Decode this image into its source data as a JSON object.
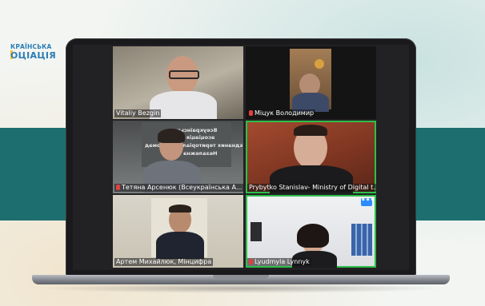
{
  "logo": {
    "line1": "КРАЇНСЬКА",
    "line2": "ОЦІАЦІЯ"
  },
  "meeting": {
    "more_button_label": "•••",
    "participants": [
      {
        "name": "Vitaliy Bezgin",
        "muted": false
      },
      {
        "name": "Міцук Володимир",
        "muted": true
      },
      {
        "name": "Тетяна Арсенюк (Всеукраїнська А...",
        "muted": true
      },
      {
        "name": "Prybytko Stanislav- Ministry of Digital t...",
        "muted": false
      },
      {
        "name": "Артем Михайлюк, Мінцифра",
        "muted": false
      },
      {
        "name": "Lyudmyla Lynnyk",
        "muted": true
      }
    ],
    "background_sign": {
      "line1": "Всеукраїнська",
      "line2": "асоціація",
      "line3": "об'єднаних територіальних громад",
      "line4": "Незалежна"
    }
  },
  "colors": {
    "band": "#1d6f6f",
    "active_speaker_border": "#2fbf4a",
    "mute_icon": "#e04040",
    "more_button": "#2d8cff"
  }
}
